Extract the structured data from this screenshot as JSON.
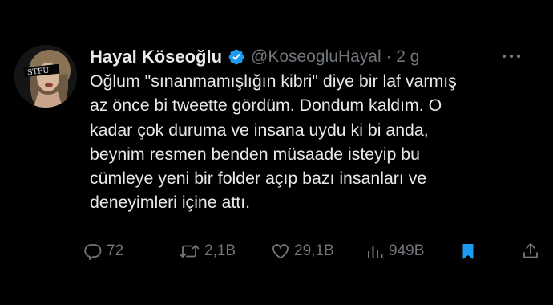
{
  "author": {
    "name": "Hayal Köseoğlu",
    "handle_line": "@KoseogluHayal · 2 g",
    "avatar_text": "STFU",
    "verified_color": "#1d9bf0"
  },
  "tweet_lines": [
    "Oğlum \"sınanmamışlığın kibri\" diye bir laf varmış",
    "az önce bi tweette gördüm. Dondum kaldım. O",
    "kadar çok duruma ve insana uydu ki bi anda,",
    "beynim resmen benden müsaade isteyip bu",
    "cümleye yeni bir folder açıp bazı insanları ve",
    "deneyimleri içine attı."
  ],
  "actions": {
    "reply_count": "72",
    "retweet_count": "2,1B",
    "like_count": "29,1B",
    "views_count": "949B"
  },
  "colors": {
    "text": "#e7e9ea",
    "muted": "#71767b",
    "bookmark_active": "#1d9bf0",
    "background": "#000000"
  }
}
